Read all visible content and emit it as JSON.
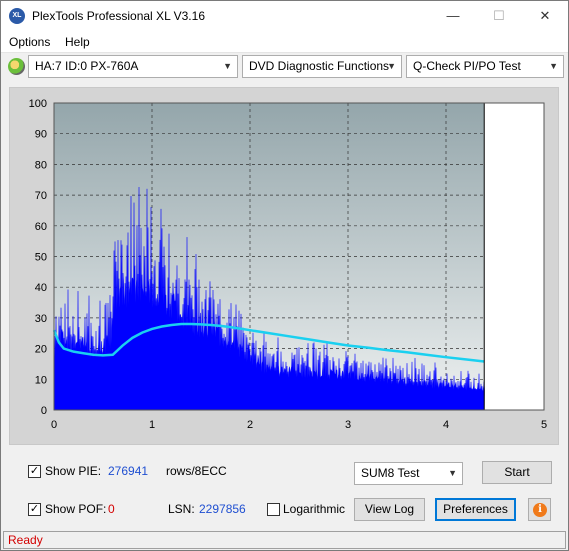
{
  "window": {
    "title": "PlexTools Professional XL V3.16",
    "app_icon_text": "XL",
    "minimize": "—",
    "maximize": "☐",
    "close": "✕"
  },
  "menu": {
    "items": [
      {
        "label": "Options"
      },
      {
        "label": "Help"
      }
    ]
  },
  "toolbar": {
    "drive_select": "HA:7 ID:0  PX-760A",
    "function_select": "DVD Diagnostic Functions",
    "test_select": "Q-Check PI/PO Test"
  },
  "chart_data": {
    "type": "area",
    "xlim": [
      0,
      5
    ],
    "ylim": [
      0,
      100
    ],
    "x_ticks": [
      "0",
      "1",
      "2",
      "3",
      "4",
      "5"
    ],
    "y_ticks": [
      "0",
      "10",
      "20",
      "30",
      "40",
      "50",
      "60",
      "70",
      "80",
      "90",
      "100"
    ],
    "grid": true,
    "end_x": 4.39,
    "colors": {
      "pie": "#0000ff",
      "curve": "#1ad0f0",
      "plot_bg_top": "#94a6ab",
      "plot_bg_bottom": "#eef1f1"
    },
    "series": [
      {
        "type": "area",
        "x": [
          0,
          0.05,
          0.1,
          0.2,
          0.3,
          0.4,
          0.5,
          0.58,
          0.6,
          0.62,
          0.7,
          0.8,
          0.9,
          1.0,
          1.1,
          1.2,
          1.3,
          1.4,
          1.5,
          1.6,
          1.7,
          1.8,
          1.9,
          2.0,
          2.05,
          2.1,
          2.2,
          2.4,
          2.6,
          2.8,
          3.0,
          3.2,
          3.4,
          3.6,
          3.8,
          4.0,
          4.2,
          4.39
        ],
        "values": [
          30,
          35,
          33,
          31,
          32,
          30,
          31,
          31,
          45,
          55,
          58,
          62,
          60,
          57,
          55,
          52,
          48,
          44,
          42,
          40,
          36,
          33,
          30,
          27,
          25,
          22,
          20,
          19,
          18,
          18,
          17,
          16,
          15,
          14,
          13,
          12,
          11,
          10
        ]
      },
      {
        "type": "line",
        "x": [
          0,
          0.05,
          0.1,
          0.2,
          0.3,
          0.4,
          0.5,
          0.6,
          0.7,
          0.8,
          0.9,
          1.0,
          1.1,
          1.2,
          1.3,
          1.4,
          1.5,
          1.6,
          1.7,
          1.8,
          1.9,
          2.0,
          2.2,
          2.4,
          2.6,
          2.8,
          3.0,
          3.2,
          3.4,
          3.6,
          3.8,
          4.0,
          4.2,
          4.39
        ],
        "values": [
          26,
          22,
          20,
          19,
          18.5,
          18,
          17.8,
          18,
          21,
          23.5,
          25.2,
          26.4,
          27.2,
          27.7,
          28,
          28,
          27.9,
          27.7,
          27.4,
          27,
          26.5,
          26,
          25,
          24,
          23,
          22,
          21,
          20.3,
          19.5,
          18.8,
          18,
          17.2,
          16.5,
          15.8
        ]
      }
    ]
  },
  "controls": {
    "show_pie_label": "Show PIE:",
    "pie_value": "276941",
    "rows_label": "rows/8ECC",
    "test_mode": "SUM8 Test",
    "start_button": "Start",
    "show_pof_label": "Show POF:",
    "pof_value": "0",
    "lsn_label": "LSN:",
    "lsn_value": "2297856",
    "logarithmic_label": "Logarithmic",
    "view_log_button": "View Log",
    "preferences_button": "Preferences",
    "info_button_glyph": "i",
    "show_pie_checked": "✓",
    "show_pof_checked": "✓"
  },
  "status": {
    "text": "Ready"
  }
}
